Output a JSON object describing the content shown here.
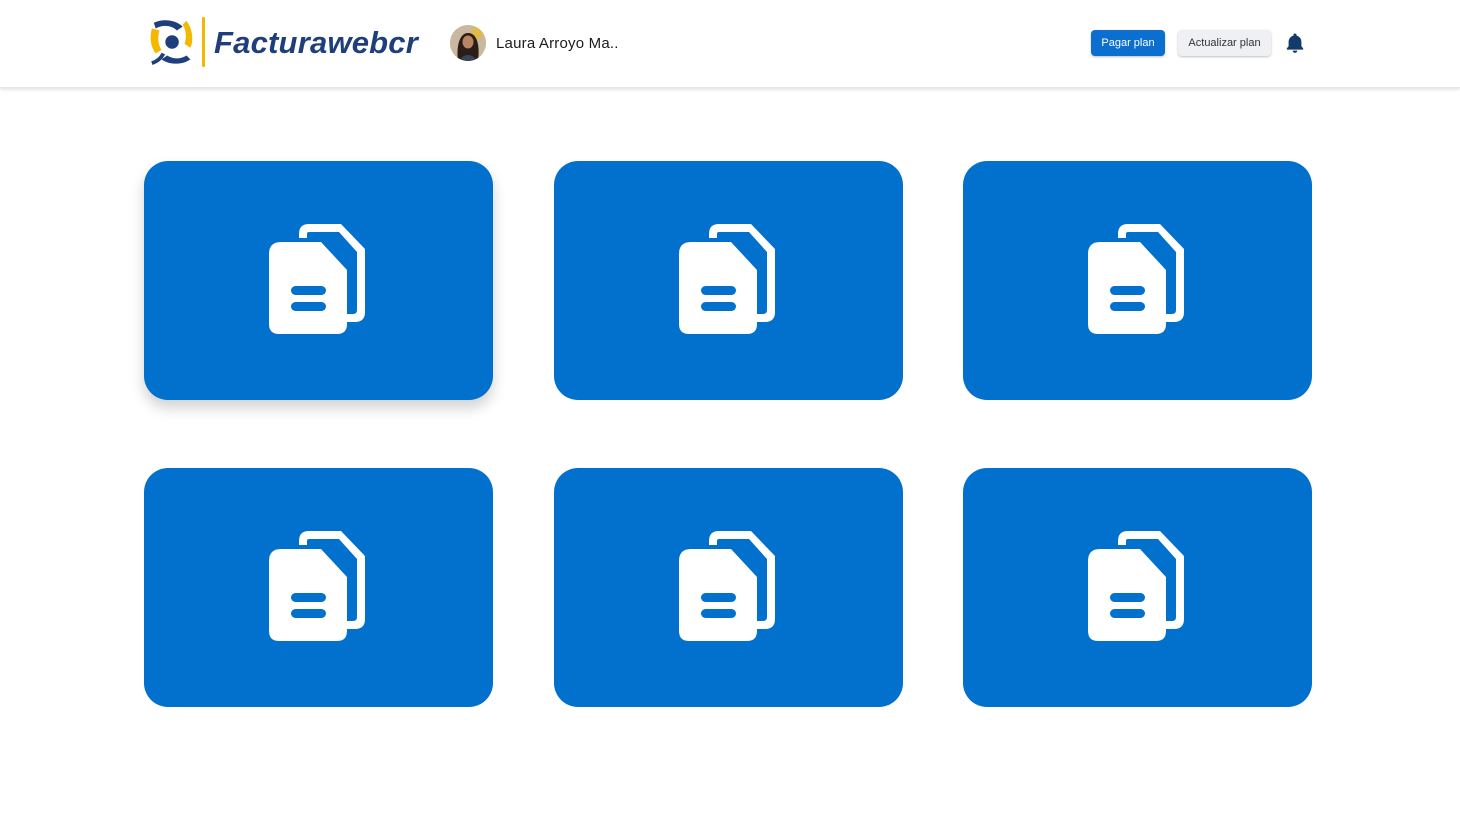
{
  "brand": {
    "name": "Facturawebcr"
  },
  "user": {
    "name": "Laura Arroyo Ma.."
  },
  "header": {
    "pay_button": "Pagar plan",
    "update_button": "Actualizar plan",
    "notification_icon": "bell-icon"
  },
  "cards": [
    {
      "icon": "documents-icon"
    },
    {
      "icon": "documents-icon"
    },
    {
      "icon": "documents-icon"
    },
    {
      "icon": "documents-icon"
    },
    {
      "icon": "documents-icon"
    },
    {
      "icon": "documents-icon"
    }
  ],
  "colors": {
    "accent": "#0270cd",
    "brand_navy": "#1f3f7c",
    "brand_yellow": "#f5b800"
  }
}
